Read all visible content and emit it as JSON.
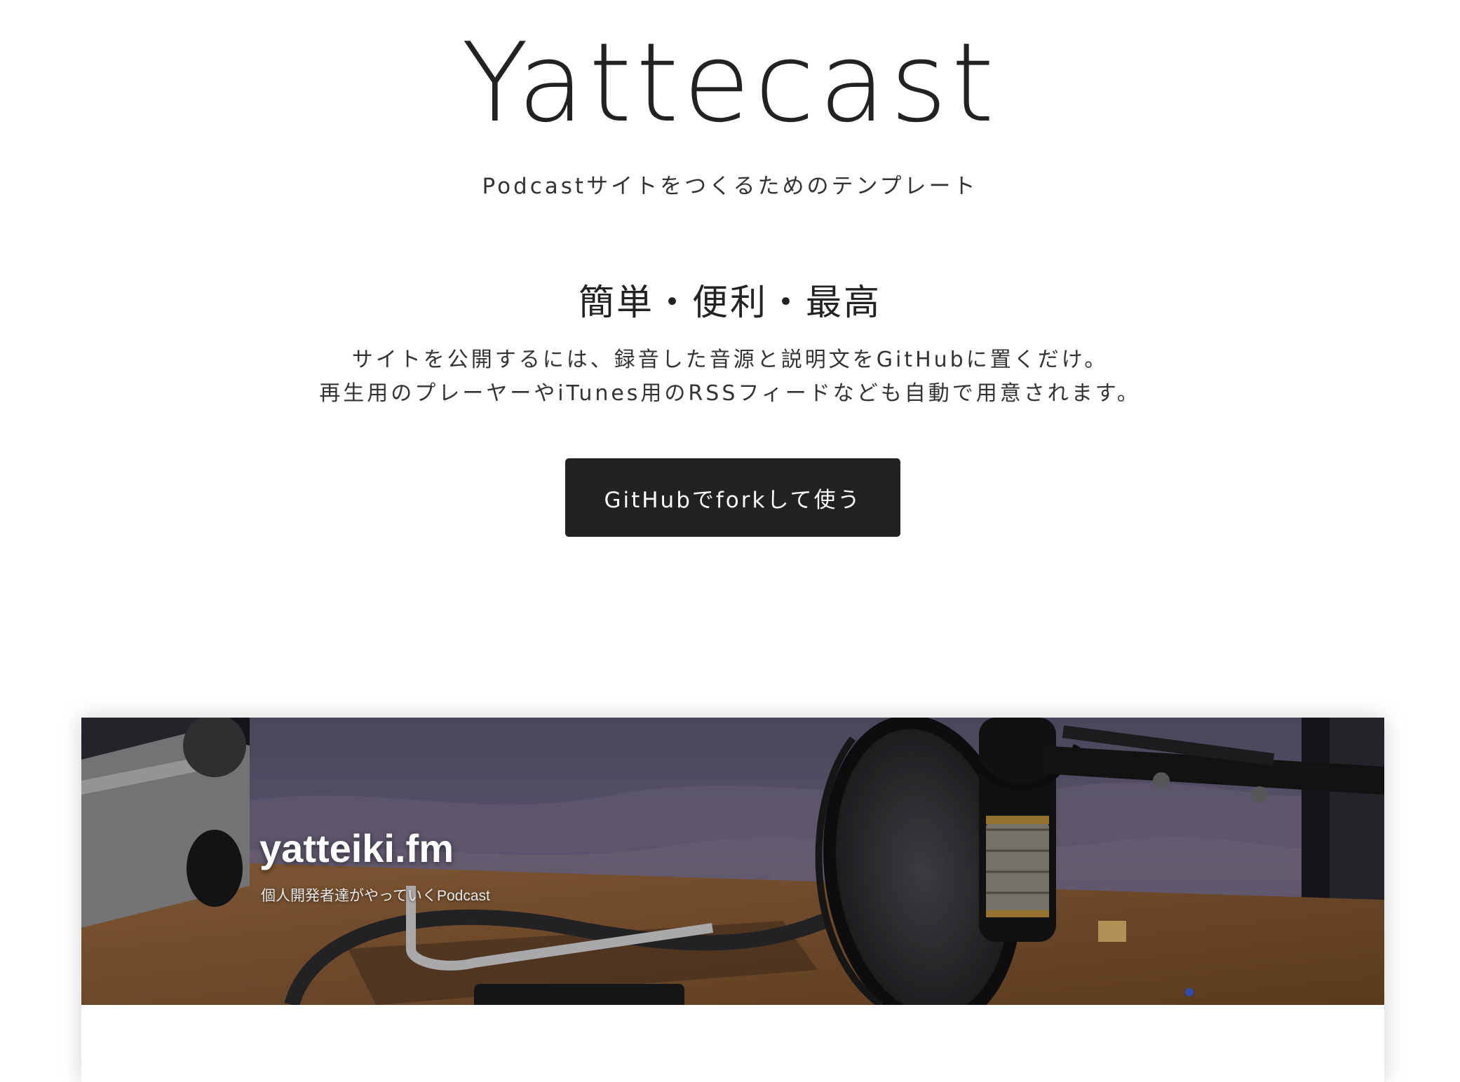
{
  "site": {
    "title": "Yattecast",
    "tagline": "Podcastサイトをつくるためのテンプレート"
  },
  "hero": {
    "headline": "簡単・便利・最高",
    "description": [
      "サイトを公開するには、録音した音源と説明文をGitHubに置くだけ。",
      "再生用のプレーヤーやiTunes用のRSSフィードなども自動で用意されます。"
    ],
    "cta_label": "GitHubでforkして使う"
  },
  "preview": {
    "title": "yatteiki.fm",
    "subtitle": "個人開発者達がやっていくPodcast"
  },
  "colors": {
    "text": "#222222",
    "button_bg": "#222222",
    "button_text": "#ffffff",
    "background": "#ffffff"
  }
}
